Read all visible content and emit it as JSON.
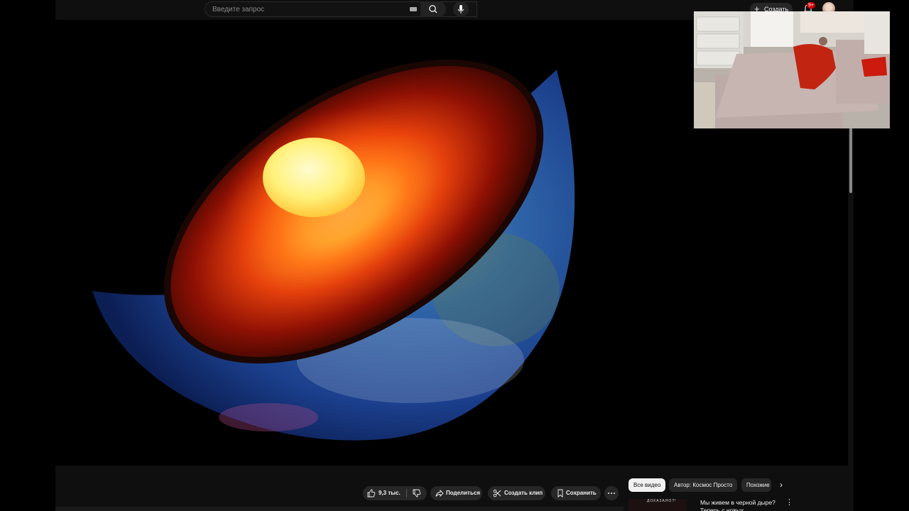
{
  "search": {
    "placeholder": "Введите запрос"
  },
  "header": {
    "create_label": "Создать",
    "notification_badge": "9+"
  },
  "actions": {
    "like_count": "9,3 тыс.",
    "share_label": "Поделиться",
    "clip_label": "Создать клип",
    "save_label": "Сохранить"
  },
  "filters": {
    "chips": [
      "Все видео",
      "Автор: Космос Просто",
      "Похожие"
    ],
    "selected": "Все видео"
  },
  "recommendation": {
    "thumbnail_text": "ДОКАЗАНО?!",
    "title": "Мы живем в черной дыре? Теперь с новых..."
  },
  "icons": {
    "search": "search-icon",
    "mic": "mic-icon",
    "keyboard": "keyboard-icon",
    "bell": "bell-icon",
    "like": "thumbs-up-icon",
    "dislike": "thumbs-down-icon",
    "share": "share-icon",
    "clip": "scissors-icon",
    "save": "bookmark-icon",
    "more": "more-horizontal-icon",
    "chevron": "chevron-right-icon"
  }
}
